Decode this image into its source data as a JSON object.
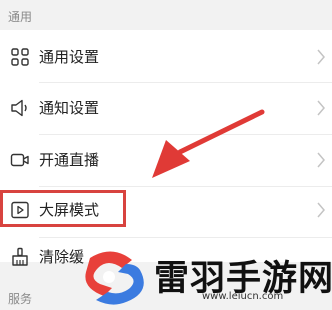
{
  "sections": {
    "general_label": "通用",
    "service_label": "服务"
  },
  "rows": [
    {
      "label": "通用设置",
      "icon": "grid-icon"
    },
    {
      "label": "通知设置",
      "icon": "speaker-icon"
    },
    {
      "label": "开通直播",
      "icon": "video-camera-icon"
    },
    {
      "label": "大屏模式",
      "icon": "play-screen-icon"
    },
    {
      "label": "清除缓",
      "icon": "broom-icon"
    }
  ],
  "watermark": {
    "brand": "雷羽手游网",
    "url": "www.leiucn.com"
  },
  "colors": {
    "highlight": "#d8433f",
    "arrow": "#e03a36",
    "logo_red": "#e8403a",
    "logo_blue": "#3b7be0"
  }
}
